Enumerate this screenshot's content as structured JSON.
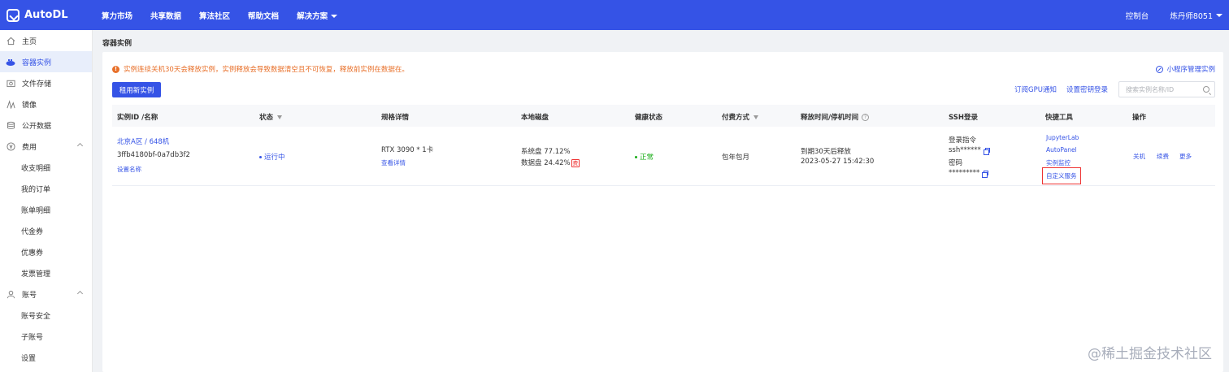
{
  "brand": "AutoDL",
  "topnav": [
    "算力市场",
    "共享数据",
    "算法社区",
    "帮助文档"
  ],
  "topnav_dropdown": "解决方案",
  "top_right": {
    "console": "控制台",
    "user": "炼丹师8051"
  },
  "sidebar": {
    "items": [
      {
        "label": "主页",
        "icon": "home-icon"
      },
      {
        "label": "容器实例",
        "icon": "container-icon",
        "active": true
      },
      {
        "label": "文件存储",
        "icon": "folder-icon"
      },
      {
        "label": "镜像",
        "icon": "image-icon"
      },
      {
        "label": "公开数据",
        "icon": "database-icon"
      },
      {
        "label": "费用",
        "icon": "yen-icon",
        "group": true
      },
      {
        "label": "收支明细",
        "sub": true
      },
      {
        "label": "我的订单",
        "sub": true
      },
      {
        "label": "账单明细",
        "sub": true
      },
      {
        "label": "代金券",
        "sub": true
      },
      {
        "label": "优惠券",
        "sub": true
      },
      {
        "label": "发票管理",
        "sub": true
      },
      {
        "label": "账号",
        "icon": "user-icon",
        "group": true
      },
      {
        "label": "账号安全",
        "sub": true
      },
      {
        "label": "子账号",
        "sub": true
      },
      {
        "label": "设置",
        "sub": true
      }
    ]
  },
  "breadcrumb": "容器实例",
  "notice": "实例连续关机30天会释放实例，实例释放会导致数据清空且不可恢复，释放前实例在数据在。",
  "mini_program": "小程序管理实例",
  "rent_button": "租用新实例",
  "subscribe_gpu": "订阅GPU通知",
  "set_key_login": "设置密钥登录",
  "search": {
    "placeholder": "搜索实例名称/ID",
    "value": ""
  },
  "columns": [
    "实例ID /名称",
    "状态",
    "规格详情",
    "本地磁盘",
    "健康状态",
    "付费方式",
    "释放时间/停机时间",
    "SSH登录",
    "快捷工具",
    "操作"
  ],
  "row": {
    "region": "北京A区 / 648机",
    "id": "3ffb4180bf-0a7db3f2",
    "set_name": "设置名称",
    "status": "运行中",
    "spec": "RTX 3090 * 1卡",
    "spec_detail": "查看详情",
    "sys_disk": "系统盘 77.12%",
    "data_disk": "数据盘 24.42%",
    "fee_tag": "费",
    "health": "正常",
    "billing": "包年包月",
    "release": "到期30天后释放",
    "release_time": "2023-05-27 15:42:30",
    "ssh_cmd_label": "登录指令",
    "ssh_cmd": "ssh******",
    "pwd_label": "密码",
    "pwd": "*********",
    "tools": [
      "JupyterLab",
      "AutoPanel",
      "实例监控",
      "自定义服务"
    ],
    "ops": [
      "关机",
      "续费",
      "更多"
    ]
  },
  "watermark": "@稀土掘金技术社区",
  "colors": {
    "primary": "#3553e6",
    "warning": "#e8702a",
    "success": "#1aad19",
    "highlight": "#ee3333"
  }
}
